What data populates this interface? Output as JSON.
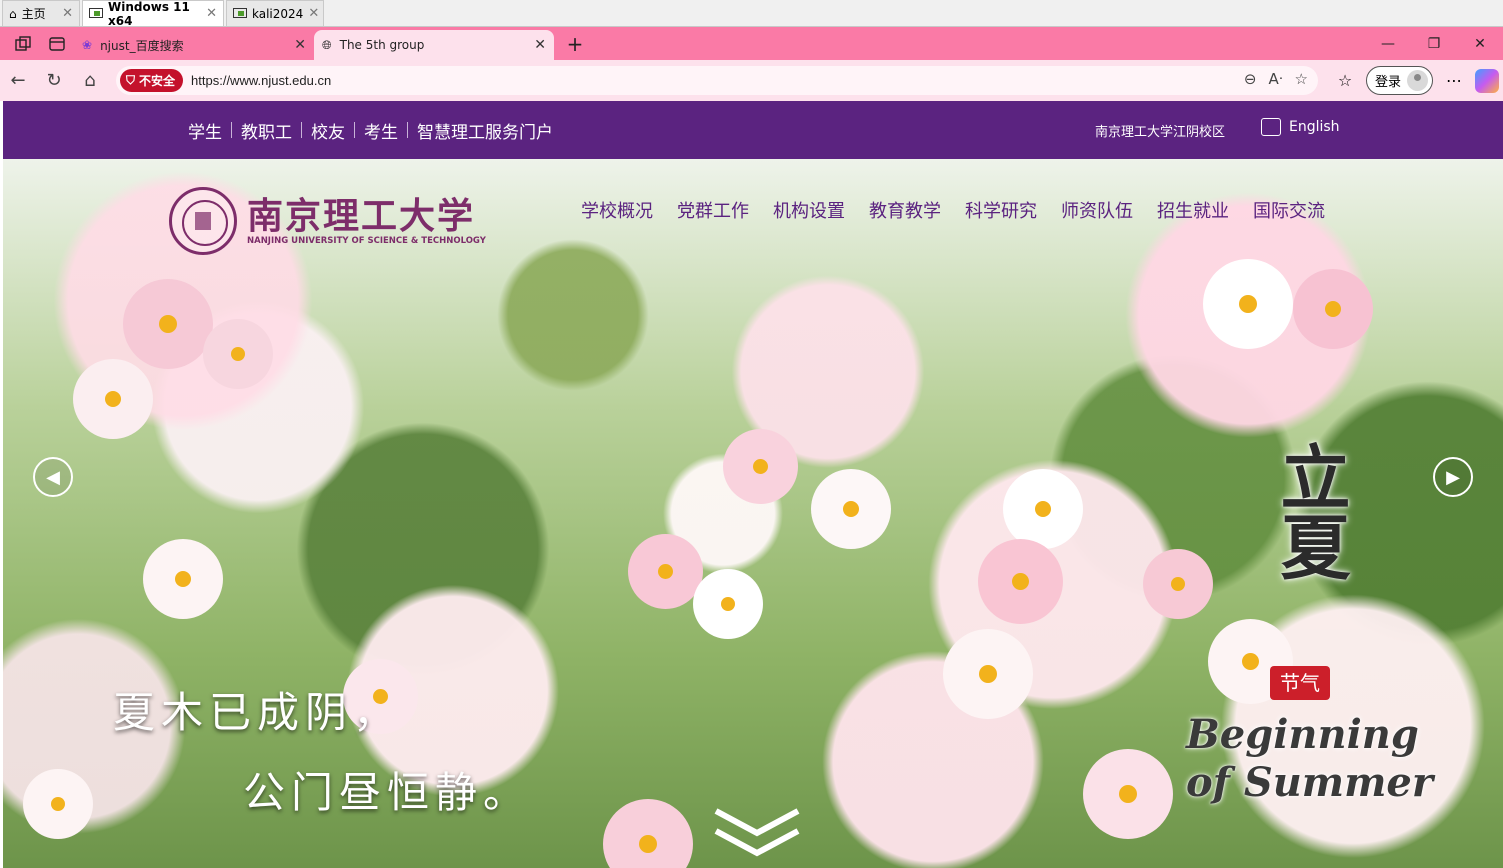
{
  "vm_tabs": [
    {
      "label": "主页",
      "icon": "home-icon"
    },
    {
      "label": "Windows 11 x64",
      "icon": "vm-icon",
      "active": true
    },
    {
      "label": "kali2024",
      "icon": "vm-icon"
    }
  ],
  "browser": {
    "tabs": [
      {
        "title": "njust_百度搜索",
        "icon": "baidu-paw-icon"
      },
      {
        "title": "The 5th group",
        "icon": "globe-icon",
        "active": true
      }
    ],
    "security_label": "不安全",
    "url": "https://www.njust.edu.cn",
    "login_label": "登录",
    "accent_color": "#fa7aa6"
  },
  "site": {
    "top_links": [
      "学生",
      "教职工",
      "校友",
      "考生",
      "智慧理工服务门户"
    ],
    "campus_link": "南京理工大学江阴校区",
    "english_link": "English",
    "logo_cn": "南京理工大学",
    "logo_en": "NANJING UNIVERSITY OF SCIENCE & TECHNOLOGY",
    "main_nav": [
      "学校概况",
      "党群工作",
      "机构设置",
      "教育教学",
      "科学研究",
      "师资队伍",
      "招生就业",
      "国际交流"
    ],
    "brand_color": "#5b2380"
  },
  "hero": {
    "poem_line1": "夏木已成阴，",
    "poem_line2": "公门昼恒静。",
    "solar_term_cn": "立夏",
    "solar_term_badge": "节气",
    "solar_term_en_line1": "Beginning",
    "solar_term_en_line2": "of Summer"
  }
}
